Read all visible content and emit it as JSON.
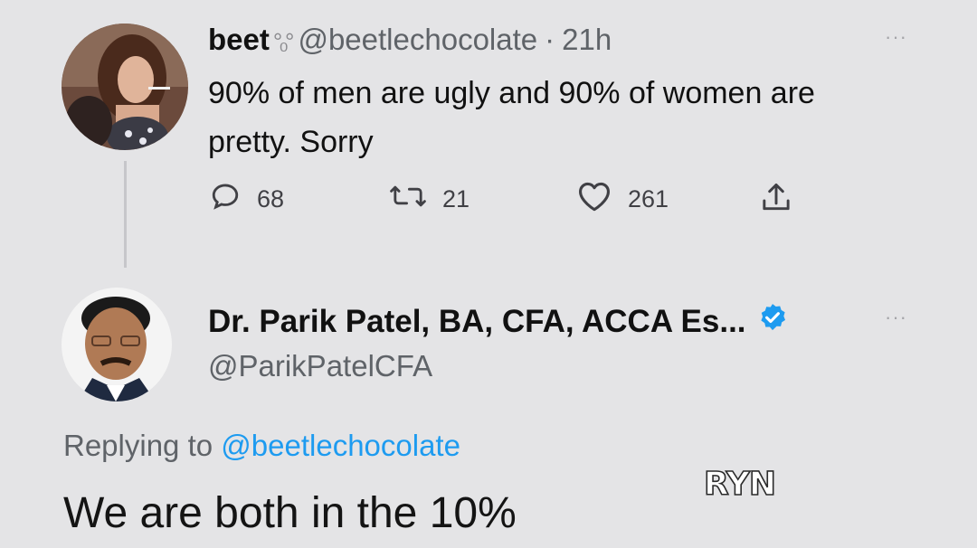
{
  "tweet": {
    "author_name": "beet",
    "author_emoji": "°₀°",
    "handle": "@beetlechocolate",
    "separator": "·",
    "time": "21h",
    "text": "90% of men are ugly and 90% of women are pretty. Sorry",
    "replies": "68",
    "retweets": "21",
    "likes": "261",
    "more_label": "···"
  },
  "reply": {
    "author_name": "Dr. Parik Patel, BA, CFA, ACCA Es...",
    "handle": "@ParikPatelCFA",
    "verified": true,
    "replying_prefix": "Replying to",
    "replying_handle": "@beetlechocolate",
    "text": "We are both in the 10%",
    "more_label": "···"
  },
  "watermark": "RYN",
  "colors": {
    "background": "#e4e4e6",
    "accent": "#1d9bf0",
    "muted": "#5f6368"
  }
}
